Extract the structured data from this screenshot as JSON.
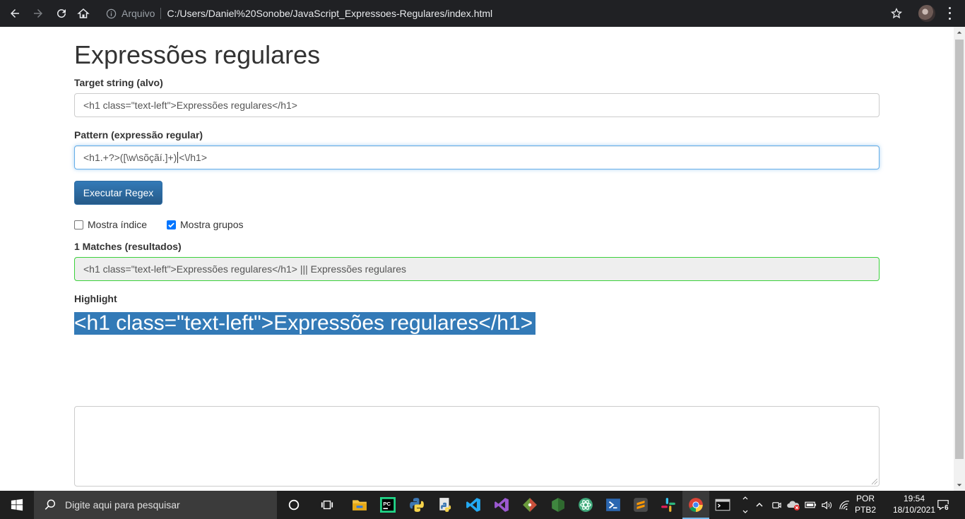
{
  "browser": {
    "address_prefix": "Arquivo",
    "url": "C:/Users/Daniel%20Sonobe/JavaScript_Expressoes-Regulares/index.html"
  },
  "page": {
    "title": "Expressões regulares",
    "target_label": "Target string (alvo)",
    "target_value": "<h1 class=\"text-left\">Expressões regulares</h1>",
    "pattern_label": "Pattern (expressão regular)",
    "pattern_value_before_caret": "<h1.+?>([\\w\\sõçãí.]+)",
    "pattern_value_after_caret": "<\\/h1>",
    "run_button": "Executar Regex",
    "show_index_label": "Mostra índice",
    "show_index_checked": false,
    "show_groups_label": "Mostra grupos",
    "show_groups_checked": true,
    "matches_label": "1 Matches (resultados)",
    "matches_value": "<h1 class=\"text-left\">Expressões regulares</h1> ||| Expressões regulares",
    "highlight_label": "Highlight",
    "highlight_text": "<h1 class=\"text-left\">Expressões regulares</h1>",
    "textarea_value": ""
  },
  "taskbar": {
    "search_placeholder": "Digite aqui para pesquisar",
    "language_line1": "POR",
    "language_line2": "PTB2",
    "time": "19:54",
    "date": "18/10/2021",
    "notification_count": "6",
    "apps": [
      "cortana",
      "task-view",
      "file-explorer",
      "pycharm",
      "python-idle",
      "vscode",
      "visual-studio",
      "git",
      "nodejs",
      "atom",
      "powershell",
      "sublime-text",
      "slack",
      "chrome",
      "terminal"
    ]
  },
  "colors": {
    "accent_blue": "#337ab7",
    "match_border": "#3bd13b",
    "chrome_bg": "#202124",
    "taskbar_bg": "#1f1f1f"
  }
}
